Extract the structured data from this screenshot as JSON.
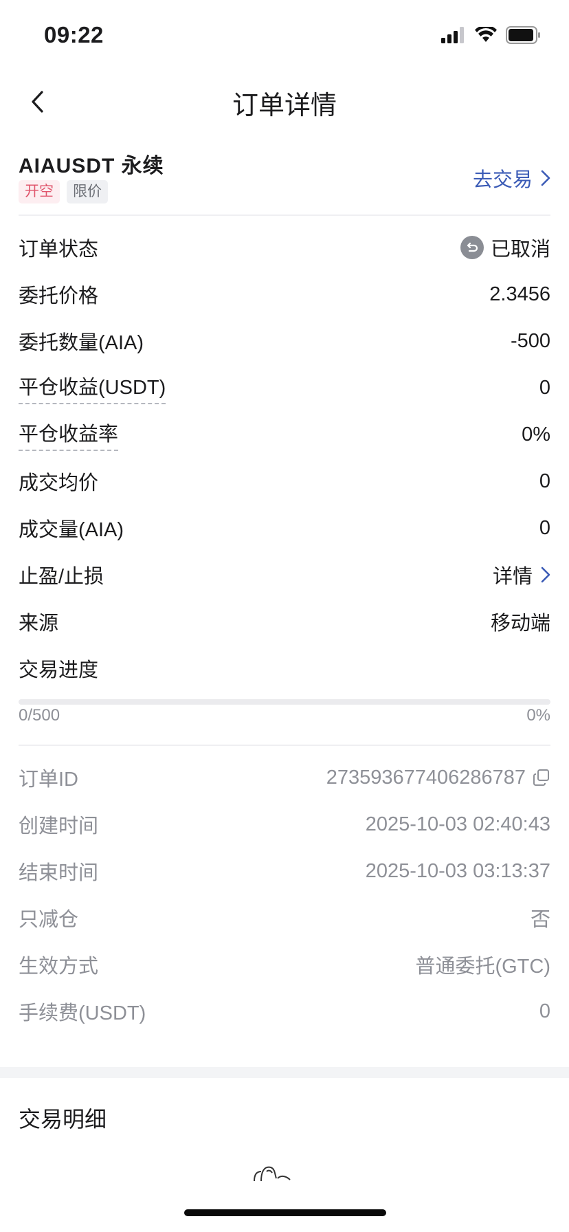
{
  "status_bar": {
    "time": "09:22"
  },
  "nav": {
    "title": "订单详情"
  },
  "header": {
    "symbol": "AIAUSDT 永续",
    "tag_open": "开空",
    "tag_limit": "限价",
    "go_trade": "去交易"
  },
  "details": [
    {
      "label": "订单状态",
      "value": "已取消"
    },
    {
      "label": "委托价格",
      "value": "2.3456"
    },
    {
      "label": "委托数量(AIA)",
      "value": "-500"
    },
    {
      "label": "平仓收益(USDT)",
      "value": "0"
    },
    {
      "label": "平仓收益率",
      "value": "0%"
    },
    {
      "label": "成交均价",
      "value": "0"
    },
    {
      "label": "成交量(AIA)",
      "value": "0"
    },
    {
      "label": "止盈/止损",
      "value": "详情"
    },
    {
      "label": "来源",
      "value": "移动端"
    },
    {
      "label": "交易进度"
    }
  ],
  "progress": {
    "left_label": "0/500",
    "right_label": "0%",
    "fraction": 0
  },
  "info": [
    {
      "label": "订单ID",
      "value": "273593677406286787"
    },
    {
      "label": "创建时间",
      "value": "2025-10-03 02:40:43"
    },
    {
      "label": "结束时间",
      "value": "2025-10-03 03:13:37"
    },
    {
      "label": "只减仓",
      "value": "否"
    },
    {
      "label": "生效方式",
      "value": "普通委托(GTC)"
    },
    {
      "label": "手续费(USDT)",
      "value": "0"
    }
  ],
  "trade_details": {
    "title": "交易明细"
  },
  "icons": {
    "back": "chevron-left-icon",
    "go_trade": "chevron-right-icon",
    "status": "cancelled-icon",
    "copy": "copy-icon"
  },
  "colors": {
    "link": "#3b5bb6",
    "tag_open": "#e0566d",
    "muted": "#8e9097"
  }
}
